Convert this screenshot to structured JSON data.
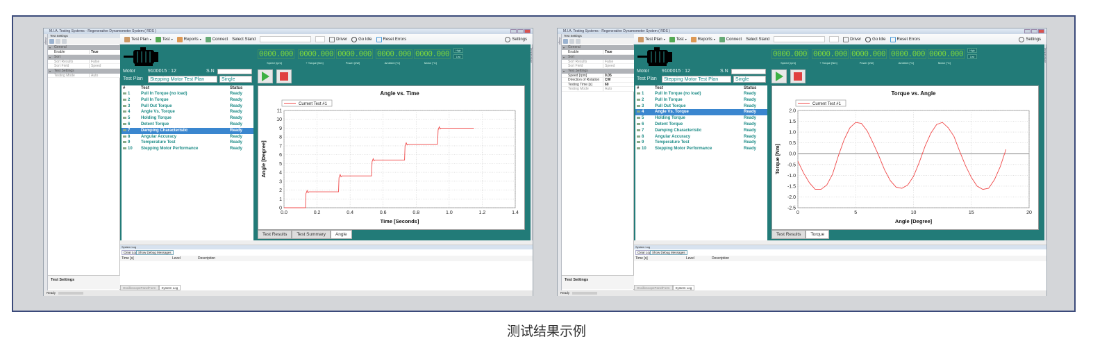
{
  "caption": "测试结果示例",
  "windows": [
    {
      "title": "M.I.A. Testing Systems - Regenerative Dynamometer System ( RDS )",
      "left_strip": "Usage",
      "right_strip": "Temperature",
      "property_panel": {
        "title": "Test Settings",
        "footer": "Test Settings",
        "categories": [
          {
            "name": "General",
            "rows": [
              {
                "k": "Enable",
                "v": "True",
                "dim": false
              }
            ]
          },
          {
            "name": "Sort",
            "rows": [
              {
                "k": "Sort Results",
                "v": "False",
                "dim": true
              },
              {
                "k": "Sort Field",
                "v": "Speed",
                "dim": true
              }
            ]
          },
          {
            "name": "Test Settings",
            "rows": [
              {
                "k": "Testing Mode",
                "v": "Auto",
                "dim": true
              }
            ]
          }
        ]
      },
      "toolbar": {
        "test_plan": "Test Plan",
        "test": "Test",
        "reports": "Reports",
        "connect": "Connect",
        "select_stand": "Select Stand",
        "driver": "Driver",
        "go_idle": "Go Idle",
        "reset_errors": "Reset Errors",
        "settings": "Settings"
      },
      "readouts": [
        {
          "value": "0000.000",
          "label": "Speed [rpm]"
        },
        {
          "value": "0000.000",
          "label": "+ Torque [Nm]"
        },
        {
          "value": "0000.000",
          "label": "Power [kW]"
        },
        {
          "value": "0000.000",
          "label": "Ambient [°C]"
        },
        {
          "value": "0000.000",
          "label": "Motor [°C]"
        }
      ],
      "high": "High",
      "low": "Low",
      "motor_label": "Motor",
      "motor_value": "9100015 : 12",
      "sn_label": "S.N",
      "sn_value": "",
      "test_plan_label": "Test Plan",
      "test_plan_value": "Stepping Motor Test Plan",
      "mode_value": "Single",
      "list_headers": [
        "#",
        "Test",
        "Status"
      ],
      "tests": [
        [
          "1",
          "Pull In Torque (no load)",
          "Ready"
        ],
        [
          "2",
          "Pull In Torque",
          "Ready"
        ],
        [
          "3",
          "Pull Out Torque",
          "Ready"
        ],
        [
          "4",
          "Angle Vs. Torque",
          "Ready"
        ],
        [
          "5",
          "Holding Torque",
          "Ready"
        ],
        [
          "6",
          "Detent Torque",
          "Ready"
        ],
        [
          "7",
          "Damping Characteristic",
          "Ready"
        ],
        [
          "8",
          "Angular Accuracy",
          "Ready"
        ],
        [
          "9",
          "Temperature Test",
          "Ready"
        ],
        [
          "10",
          "Stepping Motor Performance",
          "Ready"
        ]
      ],
      "selected_index": 6,
      "chart_tabs": [
        "Test Results",
        "Test Summary",
        "Angle"
      ],
      "active_tab": 2,
      "log": {
        "title": "System Log",
        "clear": "Clear Log",
        "debug": "Show Debug Messages",
        "cols": [
          "Time [s]",
          "Level",
          "Description"
        ]
      },
      "bottom_tabs": [
        "OscilloscopePanelForm",
        "System Log"
      ],
      "status": "Ready"
    },
    {
      "title": "M.I.A. Testing Systems - Regenerative Dynamometer System ( RDS )",
      "left_strip": "Usage",
      "right_strip": "Temperature",
      "property_panel": {
        "title": "Test Settings",
        "footer": "Test Settings",
        "categories": [
          {
            "name": "General",
            "rows": [
              {
                "k": "Enable",
                "v": "True",
                "dim": false
              }
            ]
          },
          {
            "name": "Sort",
            "rows": [
              {
                "k": "Sort Results",
                "v": "False",
                "dim": true
              },
              {
                "k": "Sort Field",
                "v": "Speed",
                "dim": true
              }
            ]
          },
          {
            "name": "Test Settings",
            "rows": [
              {
                "k": "Speed [rpm]",
                "v": "0.05",
                "dim": false
              },
              {
                "k": "Direction of Rotation",
                "v": "CW",
                "dim": false
              },
              {
                "k": "Testing Time [s]",
                "v": "60",
                "dim": false
              },
              {
                "k": "Testing Mode",
                "v": "Auto",
                "dim": true
              }
            ]
          }
        ]
      },
      "toolbar": {
        "test_plan": "Test Plan",
        "test": "Test",
        "reports": "Reports",
        "connect": "Connect",
        "select_stand": "Select Stand",
        "driver": "Driver",
        "go_idle": "Go Idle",
        "reset_errors": "Reset Errors",
        "settings": "Settings"
      },
      "readouts": [
        {
          "value": "0000.000",
          "label": "Speed [rpm]"
        },
        {
          "value": "0000.000",
          "label": "+ Torque [Nm]"
        },
        {
          "value": "0000.000",
          "label": "Power [kW]"
        },
        {
          "value": "0000.000",
          "label": "Ambient [°C]"
        },
        {
          "value": "0000.000",
          "label": "Motor [°C]"
        }
      ],
      "high": "High",
      "low": "Low",
      "motor_label": "Motor",
      "motor_value": "9100015 : 12",
      "sn_label": "S.N",
      "sn_value": "",
      "test_plan_label": "Test Plan",
      "test_plan_value": "Stepping Motor Test Plan",
      "mode_value": "Single",
      "list_headers": [
        "#",
        "Test",
        "Status"
      ],
      "tests": [
        [
          "1",
          "Pull In Torque (no load)",
          "Ready"
        ],
        [
          "2",
          "Pull In Torque",
          "Ready"
        ],
        [
          "3",
          "Pull Out Torque",
          "Ready"
        ],
        [
          "4",
          "Angle Vs. Torque",
          "Ready"
        ],
        [
          "5",
          "Holding Torque",
          "Ready"
        ],
        [
          "6",
          "Detent Torque",
          "Ready"
        ],
        [
          "7",
          "Damping Characteristic",
          "Ready"
        ],
        [
          "8",
          "Angular Accuracy",
          "Ready"
        ],
        [
          "9",
          "Temperature Test",
          "Ready"
        ],
        [
          "10",
          "Stepping Motor Performance",
          "Ready"
        ]
      ],
      "selected_index": 3,
      "chart_tabs": [
        "Test Results",
        "Torque"
      ],
      "active_tab": 1,
      "log": {
        "title": "System Log",
        "clear": "Clear Log",
        "debug": "Show Debug Messages",
        "cols": [
          "Time [s]",
          "Level",
          "Description"
        ]
      },
      "bottom_tabs": [
        "OscilloscopePanelForm",
        "System Log"
      ],
      "status": "Ready"
    }
  ],
  "chart_data": [
    {
      "type": "line",
      "title": "Angle vs. Time",
      "xlabel": "Time [Seconds]",
      "ylabel": "Angle [Degree]",
      "xlim": [
        0,
        1.4
      ],
      "ylim": [
        0,
        11
      ],
      "xticks": [
        "0.0",
        "0.2",
        "0.4",
        "0.6",
        "0.8",
        "1.0",
        "1.2",
        "1.4"
      ],
      "yticks": [
        "0",
        "1",
        "2",
        "3",
        "4",
        "5",
        "6",
        "7",
        "8",
        "9",
        "10",
        "11"
      ],
      "grid": true,
      "legend": "top-left",
      "color": "#f04848",
      "series": [
        {
          "name": "Current Test #1",
          "x": [
            0,
            0.13,
            0.133,
            0.14,
            0.145,
            0.15,
            0.33,
            0.333,
            0.34,
            0.345,
            0.35,
            0.53,
            0.533,
            0.54,
            0.545,
            0.55,
            0.73,
            0.733,
            0.74,
            0.745,
            0.75,
            0.93,
            0.933,
            0.94,
            0.945,
            0.95,
            1.15
          ],
          "y": [
            0,
            0,
            1.6,
            1.95,
            1.7,
            1.8,
            1.8,
            3.4,
            3.75,
            3.5,
            3.6,
            3.6,
            5.2,
            5.55,
            5.3,
            5.4,
            5.4,
            7.0,
            7.35,
            7.1,
            7.2,
            7.2,
            8.8,
            9.15,
            8.9,
            9.0,
            9.0
          ]
        }
      ]
    },
    {
      "type": "line",
      "title": "Torque vs. Angle",
      "xlabel": "Angle [Degree]",
      "ylabel": "Torque [Nm]",
      "xlim": [
        0,
        20
      ],
      "ylim": [
        -2.5,
        2.0
      ],
      "xticks": [
        "0",
        "5",
        "10",
        "15",
        "20"
      ],
      "yticks": [
        "-2.5",
        "-2.0",
        "-1.5",
        "-1.0",
        "-0.5",
        "0.0",
        "0.5",
        "1.0",
        "1.5",
        "2.0"
      ],
      "grid": true,
      "legend": "top-left",
      "color": "#f04848",
      "series": [
        {
          "name": "Current Test #1",
          "x": [
            0,
            0.5,
            1,
            1.5,
            2,
            2.5,
            3,
            3.5,
            4,
            4.5,
            5,
            5.5,
            6,
            6.5,
            7,
            7.5,
            8,
            8.5,
            9,
            9.5,
            10,
            10.5,
            11,
            11.5,
            12,
            12.5,
            13,
            13.5,
            14,
            14.5,
            15,
            15.5,
            16,
            16.5,
            17,
            17.5,
            18
          ],
          "y": [
            -0.35,
            -0.9,
            -1.35,
            -1.65,
            -1.65,
            -1.45,
            -0.95,
            -0.1,
            0.65,
            1.2,
            1.45,
            1.4,
            1.05,
            0.5,
            -0.1,
            -0.75,
            -1.25,
            -1.55,
            -1.6,
            -1.45,
            -1.05,
            -0.4,
            0.35,
            0.95,
            1.35,
            1.45,
            1.2,
            0.8,
            0.1,
            -0.55,
            -1.1,
            -1.5,
            -1.65,
            -1.6,
            -1.2,
            -0.6,
            0.2
          ]
        }
      ]
    }
  ]
}
